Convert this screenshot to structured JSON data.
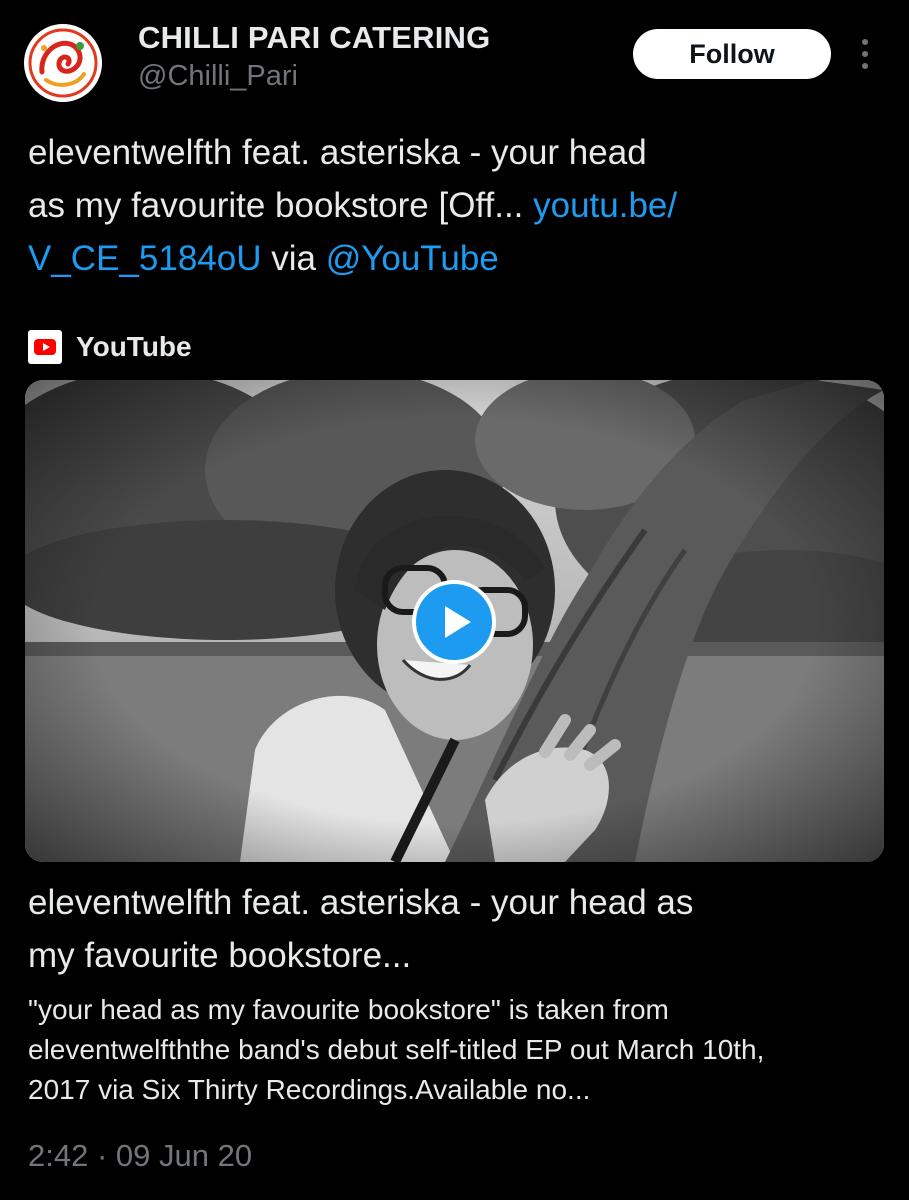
{
  "account": {
    "display_name": "CHILLI PARI CATERING",
    "handle": "@Chilli_Pari"
  },
  "actions": {
    "follow_label": "Follow",
    "more_icon": "more-vertical-icon"
  },
  "tweet": {
    "line1": "eleventwelfth feat. asteriska - your head",
    "line2_text": "as my favourite bookstore [Off... ",
    "link_part1": "youtu.be/",
    "link_part2": "V_CE_5184oU",
    "via_text": " via ",
    "mention": "@YouTube"
  },
  "card": {
    "source_icon": "youtube-icon",
    "source_name": "YouTube",
    "title_line1": "eleventwelfth feat. asteriska - your head as",
    "title_line2": "my favourite bookstore...",
    "desc_line1": "\"your head as my favourite bookstore\" is taken from",
    "desc_line2": "eleventwelfththe band's debut self-titled EP out March 10th,",
    "desc_line3": "2017 via Six Thirty Recordings.Available no..."
  },
  "timestamp": "2:42 · 09 Jun 20",
  "colors": {
    "background": "#000000",
    "text": "#e7e9ea",
    "muted": "#71767b",
    "link": "#1d9bf0",
    "play_button": "#1d9bf0",
    "youtube_red": "#ff0000"
  }
}
